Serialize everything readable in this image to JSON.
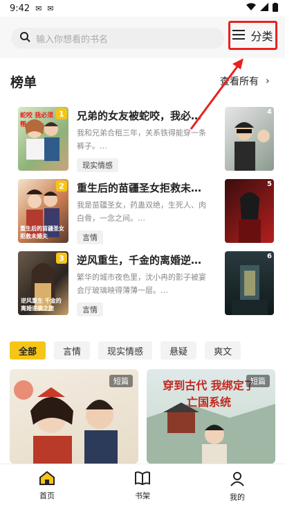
{
  "status": {
    "time": "9:42",
    "left_icons": [
      "notification-icon",
      "notification-icon"
    ],
    "right_icons": [
      "wifi-icon",
      "signal-icon",
      "battery-icon"
    ]
  },
  "search": {
    "placeholder": "输入你想看的书名"
  },
  "category_button": {
    "label": "分类"
  },
  "ranking": {
    "title": "榜单",
    "see_all": "查看所有",
    "items": [
      {
        "rank": "1",
        "title": "兄弟的女友被蛇咬，我必须…",
        "desc": "我和兄弟合租三年，关系铁得能穿一条裤子。…",
        "tag": "现实情感",
        "cover_text": "蛇咬 我必须帮",
        "side_rank": "4"
      },
      {
        "rank": "2",
        "title": "重生后的苗疆圣女拒救未婚…",
        "desc": "我是苗疆圣女，药蛊双绝，生死人、肉白骨，一念之间。…",
        "tag": "言情",
        "cover_text": "重生后的苗疆圣女拒救未婚夫",
        "side_rank": "5"
      },
      {
        "rank": "3",
        "title": "逆风重生，千金的离婚逆袭…",
        "desc": "繁华的城市夜色里，沈小冉的影子被宴会厅玻璃映得薄薄一层。…",
        "tag": "言情",
        "cover_text": "逆风重生 千金的离婚逆袭之旅",
        "side_rank": "6"
      }
    ]
  },
  "filters": [
    "全部",
    "言情",
    "现实情感",
    "悬疑",
    "爽文"
  ],
  "grid": [
    {
      "badge": "短篇",
      "cover_text": ""
    },
    {
      "badge": "短篇",
      "cover_text": "穿到古代 我绑定了亡国系统"
    }
  ],
  "tabs": [
    {
      "label": "首页",
      "icon": "home-icon"
    },
    {
      "label": "书架",
      "icon": "book-icon"
    },
    {
      "label": "我的",
      "icon": "profile-icon"
    }
  ],
  "colors": {
    "accent": "#f5c518",
    "highlight": "#e8211f"
  }
}
